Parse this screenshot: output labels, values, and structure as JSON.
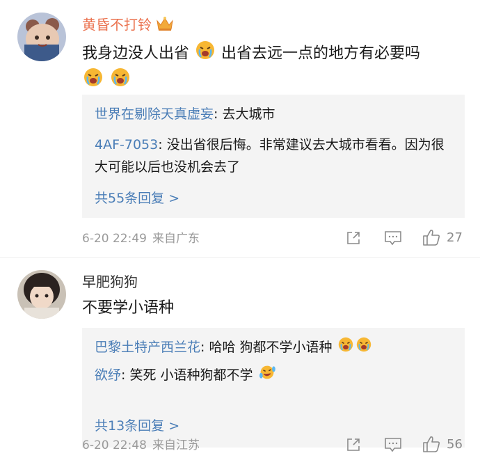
{
  "comments": [
    {
      "username": "黄昏不打铃",
      "text_a": "我身边没人出省",
      "text_b": "出省去远一点的地方有必要吗",
      "replies": [
        {
          "name": "世界在剔除天真虚妄",
          "sep": ": ",
          "text": "去大城市"
        },
        {
          "name": "4AF-7053",
          "sep": ": ",
          "text": "没出省很后悔。非常建议去大城市看看。因为很大可能以后也没机会去了"
        }
      ],
      "more_replies": "共55条回复 >",
      "time": "6-20 22:49",
      "location": "来自广东",
      "likes": "27",
      "icons": {
        "badge": "crown-icon",
        "emoji": "crying-emoji-icon"
      }
    },
    {
      "username": "早肥狗狗",
      "text_a": "不要学小语种",
      "replies": [
        {
          "name": "巴黎土特产西兰花",
          "sep": ": ",
          "text": "哈哈 狗都不学小语种"
        },
        {
          "name": "欲纾",
          "sep": ": ",
          "text": "笑死 小语种狗都不学"
        }
      ],
      "more_replies": "共13条回复 >",
      "time": "6-20 22:48",
      "location": "来自江苏",
      "likes": "56",
      "icons": {
        "emoji": "laughing-tears-emoji-icon"
      }
    }
  ],
  "colors": {
    "username": "#eb7350",
    "link": "#4b7eb7",
    "meta": "#9a9a9a",
    "reply_bg": "#f4f4f4"
  }
}
